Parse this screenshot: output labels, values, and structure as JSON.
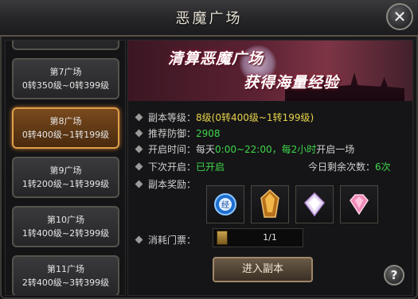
{
  "window": {
    "title": "恶魔广场"
  },
  "scenes": [
    {
      "name": "",
      "level": ""
    },
    {
      "name": "第7广场",
      "level": "0转350级~0转399级"
    },
    {
      "name": "第8广场",
      "level": "0转400级~1转199级"
    },
    {
      "name": "第9广场",
      "level": "1转200级~1转399级"
    },
    {
      "name": "第10广场",
      "level": "1转400级~2转399级"
    },
    {
      "name": "第11广场",
      "level": "2转400级~3转399级"
    }
  ],
  "selected_scene": "第8广场",
  "banner": {
    "line1": "清算恶魔广场",
    "line2": "获得海量经验"
  },
  "info": {
    "level_label": "副本等级：",
    "level_value": "8级(0转400级~1转199级)",
    "defense_label": "推荐防御：",
    "defense_value": "2908",
    "open_label": "开启时间：",
    "open_prefix": "每天",
    "open_time": "0:00~22:00",
    "open_sep": "，",
    "open_interval": "每2小时",
    "open_suffix": "开启一场",
    "next_label": "下次开启：",
    "next_value": "已开启",
    "remaining_label": "今日剩余次数：",
    "remaining_value": "6次",
    "reward_label": "副本奖励：",
    "ticket_label": "消耗门票：",
    "ticket_count": "1/1"
  },
  "rewards": [
    {
      "icon": "exp-orb-icon",
      "text": "经"
    },
    {
      "icon": "amber-crystal-icon"
    },
    {
      "icon": "white-gem-icon"
    },
    {
      "icon": "pink-gem-icon"
    }
  ],
  "buttons": {
    "enter": "进入副本",
    "help": "?",
    "close": "✕"
  },
  "colors": {
    "highlight": "#e8d34a",
    "success": "#3fd64a",
    "accent": "#e0a04a"
  }
}
